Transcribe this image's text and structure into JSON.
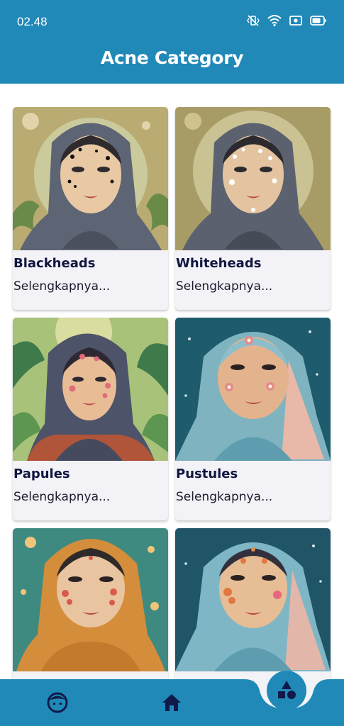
{
  "status": {
    "time": "02.48"
  },
  "header": {
    "title": "Acne Category"
  },
  "categories": [
    {
      "name": "Blackheads",
      "more": "Selengkapnya..."
    },
    {
      "name": "Whiteheads",
      "more": "Selengkapnya..."
    },
    {
      "name": "Papules",
      "more": "Selengkapnya..."
    },
    {
      "name": "Pustules",
      "more": "Selengkapnya..."
    },
    {
      "name": "",
      "more": ""
    },
    {
      "name": "",
      "more": ""
    }
  ],
  "nav": {
    "items": [
      {
        "icon": "face-icon"
      },
      {
        "icon": "home-icon"
      },
      {
        "icon": "shapes-icon",
        "active": true
      }
    ]
  },
  "colors": {
    "primary": "#2189b8",
    "text_dark": "#10163f",
    "card_bg": "#f3f2f7"
  }
}
